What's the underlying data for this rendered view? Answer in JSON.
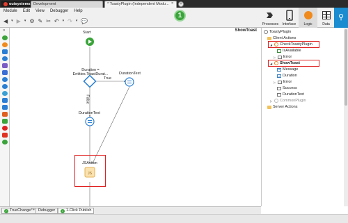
{
  "app": {
    "brand": "outsystems",
    "tabs": [
      {
        "label": "Development"
      },
      {
        "label": "* ToastyPlugin (Independent Modu...",
        "close": "×"
      }
    ],
    "new_tab": "+"
  },
  "menu": [
    "Module",
    "Edit",
    "View",
    "Debugger",
    "Help"
  ],
  "toolbar": {
    "step_number": "1",
    "right_tools": [
      {
        "label": "Processes",
        "icon": "processes-icon"
      },
      {
        "label": "Interface",
        "icon": "interface-icon"
      },
      {
        "label": "Logic",
        "icon": "logic-icon"
      },
      {
        "label": "Data",
        "icon": "data-icon"
      }
    ],
    "search_icon": "search-icon"
  },
  "canvas": {
    "flow_title": "ShowToast",
    "nodes": {
      "start": "Start",
      "if_label": "Duration = Entities.ToastDurat...",
      "true_label": "True",
      "false_label": "False",
      "assign_right": "DurationText",
      "assign_bottom": "DurationText",
      "js_action": "JSAction"
    }
  },
  "tree": {
    "root": "ToastyPlugin",
    "client_actions": "Client Actions",
    "items": [
      {
        "label": "CheckToastyPlugin",
        "level": 2,
        "type": "action",
        "bold": false
      },
      {
        "label": "IsAvailable",
        "level": 3,
        "type": "out"
      },
      {
        "label": "Error",
        "level": 3,
        "type": "local"
      },
      {
        "label": "ShowToast",
        "level": 2,
        "type": "action",
        "bold": true
      },
      {
        "label": "Message",
        "level": 3,
        "type": "in"
      },
      {
        "label": "Duration",
        "level": 3,
        "type": "in"
      },
      {
        "label": "Error",
        "level": 3,
        "type": "local"
      },
      {
        "label": "Success",
        "level": 3,
        "type": "local"
      },
      {
        "label": "DurationText",
        "level": 3,
        "type": "local"
      }
    ],
    "common_plugin": "CommonPlugin",
    "server_actions": "Server Actions"
  },
  "bottom_tabs": [
    {
      "label": "TrueChange™",
      "check": true
    },
    {
      "label": "Debugger",
      "check": false
    },
    {
      "label": "1-Click Publish",
      "check": true
    }
  ],
  "colors": {
    "accent_orange": "#f08a1c",
    "highlight_red": "#e02020",
    "flow_blue": "#2a7fd4",
    "start_green": "#3aa43a"
  }
}
